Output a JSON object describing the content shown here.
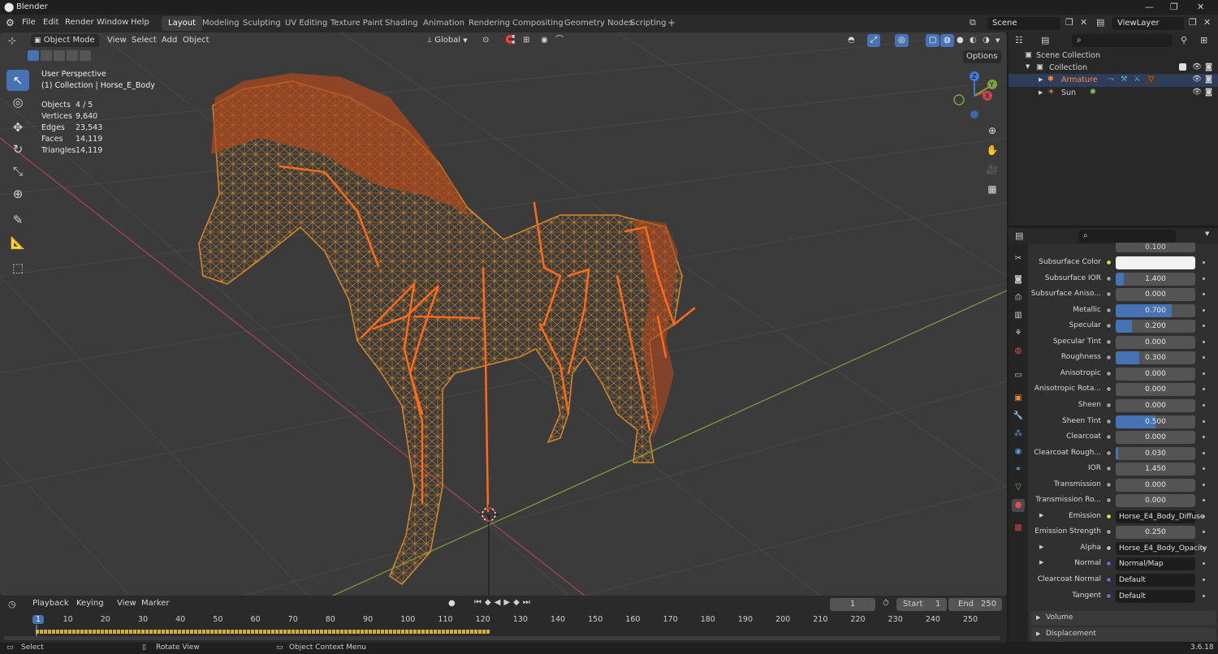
{
  "window": {
    "title": "Blender"
  },
  "menu": {
    "file": "File",
    "edit": "Edit",
    "render": "Render",
    "window": "Window",
    "help": "Help"
  },
  "workspaces": [
    "Layout",
    "Modeling",
    "Sculpting",
    "UV Editing",
    "Texture Paint",
    "Shading",
    "Animation",
    "Rendering",
    "Compositing",
    "Geometry Nodes",
    "Scripting"
  ],
  "scene": {
    "label": "Scene",
    "view_layer": "ViewLayer"
  },
  "viewport": {
    "mode": "Object Mode",
    "menus": {
      "view": "View",
      "select": "Select",
      "add": "Add",
      "object": "Object"
    },
    "transform_orientation": "Global",
    "options": "Options",
    "perspective": "User Perspective",
    "collection_info": "(1) Collection | Horse_E_Body",
    "stats": [
      {
        "label": "Objects",
        "value": "4 / 5"
      },
      {
        "label": "Vertices",
        "value": "9,640"
      },
      {
        "label": "Edges",
        "value": "23,543"
      },
      {
        "label": "Faces",
        "value": "14,119"
      },
      {
        "label": "Triangles",
        "value": "14,119"
      }
    ],
    "gizmo": {
      "x": "X",
      "y": "Y",
      "z": "Z"
    }
  },
  "outliner": {
    "root": "Scene Collection",
    "collection": "Collection",
    "items": [
      {
        "label": "Armature",
        "selected": true
      },
      {
        "label": "Sun",
        "selected": false
      }
    ]
  },
  "properties": {
    "top_value": "0.100",
    "rows": [
      {
        "label": "Subsurface Color",
        "type": "color",
        "color": "#f2f2f2"
      },
      {
        "label": "Subsurface IOR",
        "type": "num",
        "value": "1.400",
        "fill": 0.1
      },
      {
        "label": "Subsurface Aniso...",
        "type": "num",
        "value": "0.000",
        "fill": 0
      },
      {
        "label": "Metallic",
        "type": "num",
        "value": "0.700",
        "fill": 0.7
      },
      {
        "label": "Specular",
        "type": "num",
        "value": "0.200",
        "fill": 0.2
      },
      {
        "label": "Specular Tint",
        "type": "num",
        "value": "0.000",
        "fill": 0
      },
      {
        "label": "Roughness",
        "type": "num",
        "value": "0.300",
        "fill": 0.3
      },
      {
        "label": "Anisotropic",
        "type": "num",
        "value": "0.000",
        "fill": 0
      },
      {
        "label": "Anisotropic Rota...",
        "type": "num",
        "value": "0.000",
        "fill": 0
      },
      {
        "label": "Sheen",
        "type": "num",
        "value": "0.000",
        "fill": 0
      },
      {
        "label": "Sheen Tint",
        "type": "num",
        "value": "0.500",
        "fill": 0.5
      },
      {
        "label": "Clearcoat",
        "type": "num",
        "value": "0.000",
        "fill": 0
      },
      {
        "label": "Clearcoat Rough...",
        "type": "num",
        "value": "0.030",
        "fill": 0.03
      },
      {
        "label": "IOR",
        "type": "num",
        "value": "1.450",
        "fill": 0
      },
      {
        "label": "Transmission",
        "type": "num",
        "value": "0.000",
        "fill": 0
      },
      {
        "label": "Transmission Ro...",
        "type": "num",
        "value": "0.000",
        "fill": 0
      },
      {
        "label": "Emission",
        "type": "link",
        "value": "Horse_E4_Body_Diffuse",
        "arrow": true,
        "dot": "#d8d84a"
      },
      {
        "label": "Emission Strength",
        "type": "num",
        "value": "0.250",
        "fill": 0
      },
      {
        "label": "Alpha",
        "type": "link",
        "value": "Horse_E4_Body_Opacity",
        "arrow": true,
        "dot": "#bbbbbb"
      },
      {
        "label": "Normal",
        "type": "link",
        "value": "Normal/Map",
        "arrow": true,
        "dot": "#6a6ad8"
      },
      {
        "label": "Clearcoat Normal",
        "type": "link",
        "value": "Default",
        "arrow": false,
        "dot": "#6a6ad8"
      },
      {
        "label": "Tangent",
        "type": "link",
        "value": "Default",
        "arrow": false,
        "dot": "#6a6ad8"
      }
    ],
    "panels": [
      "Volume",
      "Displacement"
    ]
  },
  "timeline": {
    "menus": {
      "playback": "Playback",
      "keying": "Keying",
      "view": "View",
      "marker": "Marker"
    },
    "current_frame": "1",
    "start_label": "Start",
    "start": "1",
    "end_label": "End",
    "end": "250",
    "ticks": [
      "1",
      "10",
      "20",
      "30",
      "40",
      "50",
      "60",
      "70",
      "80",
      "90",
      "100",
      "110",
      "120",
      "130",
      "140",
      "150",
      "160",
      "170",
      "180",
      "190",
      "200",
      "210",
      "220",
      "230",
      "240",
      "250"
    ]
  },
  "status": {
    "select": "Select",
    "rotate": "Rotate View",
    "context": "Object Context Menu",
    "version": "3.6.18"
  },
  "colors": {
    "accent": "#4772b3",
    "armature": "#ff6a1a",
    "wire": "#e0902c",
    "axis_x": "#c8424b",
    "axis_y": "#7ca33d"
  }
}
